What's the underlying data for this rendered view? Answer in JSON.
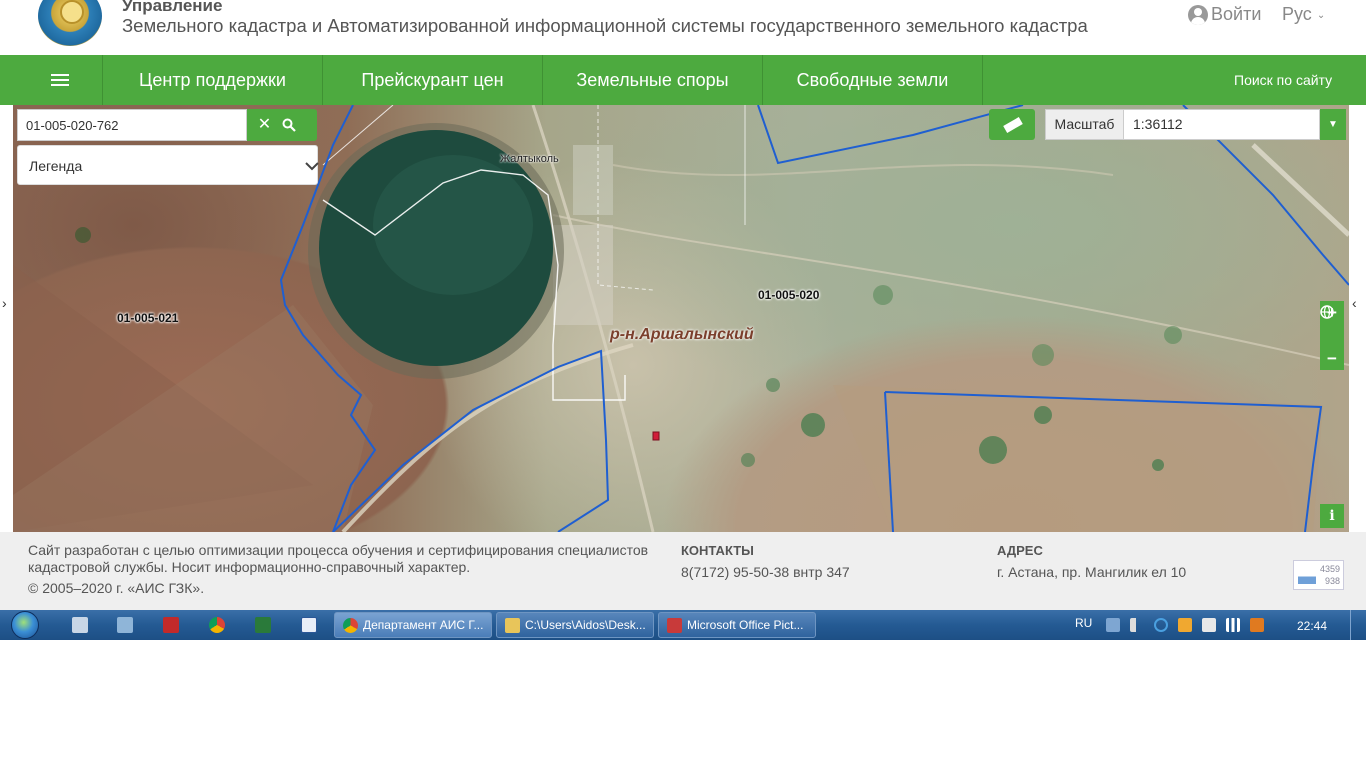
{
  "header": {
    "org_title": "Управление",
    "org_subtitle": "Земельного кадастра и Автоматизированной информационной системы государственного земельного кадастра",
    "login_label": "Войти",
    "lang_label": "Рус"
  },
  "nav": {
    "items": [
      {
        "label": "Центр поддержки"
      },
      {
        "label": "Прейскурант цен"
      },
      {
        "label": "Земельные споры"
      },
      {
        "label": "Свободные земли"
      }
    ],
    "site_search": "Поиск по сайту"
  },
  "map": {
    "search_value": "01-005-020-762",
    "legend_label": "Легенда",
    "scale_label": "Масштаб",
    "scale_value": "1:36112",
    "labels": {
      "parcel_east": "01-005-020",
      "parcel_west": "01-005-021",
      "district": "р-н.Аршалынский",
      "village": "Жалтыколь"
    },
    "zoom_in": "+",
    "zoom_out": "−",
    "info": "i",
    "side_left": "›",
    "side_right": "‹"
  },
  "footer": {
    "about": "Сайт разработан с целью оптимизации процесса обучения и сертифицирования специалистов кадастровой службы. Носит информационно-справочный характер.",
    "copyright": "© 2005–2020 г. «АИС ГЗК».",
    "contacts_heading": "КОНТАКТЫ",
    "contacts_value": "8(7172) 95-50-38 внтр 347",
    "address_heading": "АДРЕС",
    "address_value": "г. Астана, пр. Мангилик ел 10",
    "counter_top": "4359",
    "counter_bottom": "938"
  },
  "taskbar": {
    "tasks": [
      {
        "label": "Департамент АИС Г..."
      },
      {
        "label": "C:\\Users\\Aidos\\Desk..."
      },
      {
        "label": "Microsoft Office Pict..."
      }
    ],
    "lang": "RU",
    "clock": "22:44"
  },
  "colors": {
    "accent_green": "#4daa3f",
    "parcel_line": "#1f5fd1",
    "taskbar_blue": "#245a93"
  }
}
